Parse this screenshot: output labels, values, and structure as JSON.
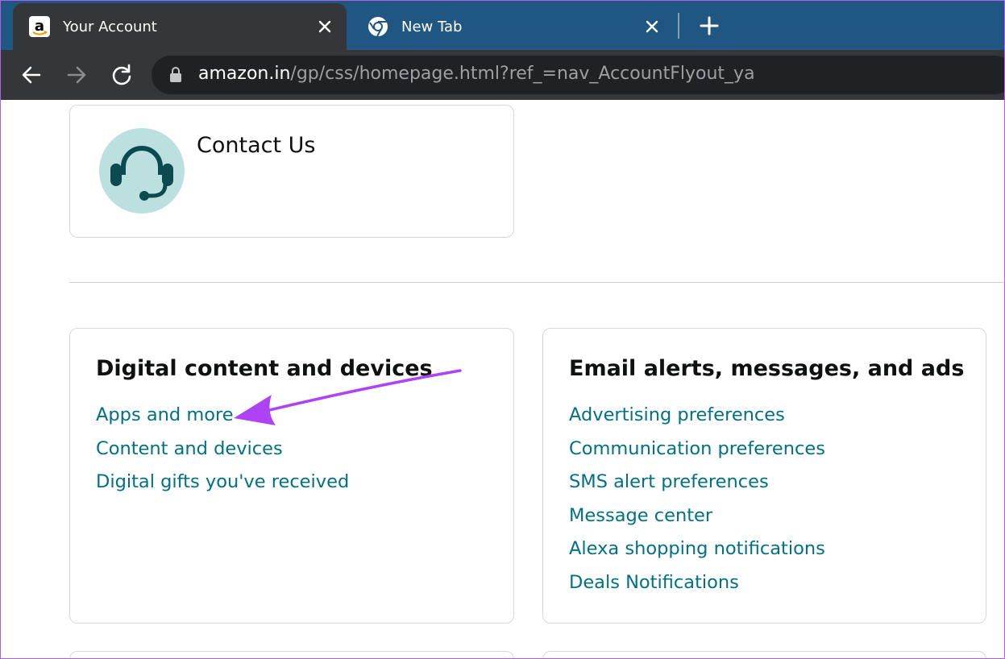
{
  "browser": {
    "tabs": [
      {
        "title": "Your Account",
        "icon": "amazon-logo-icon",
        "active": true
      },
      {
        "title": "New Tab",
        "icon": "chrome-logo-icon",
        "active": false
      }
    ],
    "url_host": "amazon.in",
    "url_path": "/gp/css/homepage.html?ref_=nav_AccountFlyout_ya"
  },
  "contact": {
    "title": "Contact Us",
    "icon": "headset-icon"
  },
  "sections": {
    "digital": {
      "title": "Digital content and devices",
      "links": [
        "Apps and more",
        "Content and devices",
        "Digital gifts you've received"
      ]
    },
    "email": {
      "title": "Email alerts, messages, and ads",
      "links": [
        "Advertising preferences",
        "Communication preferences",
        "SMS alert preferences",
        "Message center",
        "Alexa shopping notifications",
        "Deals Notifications"
      ]
    }
  },
  "annotation": {
    "color": "#b042f5",
    "points_to": "Apps and more"
  },
  "colors": {
    "link": "#007185",
    "tab_strip": "#205782",
    "toolbar": "#35363a"
  }
}
